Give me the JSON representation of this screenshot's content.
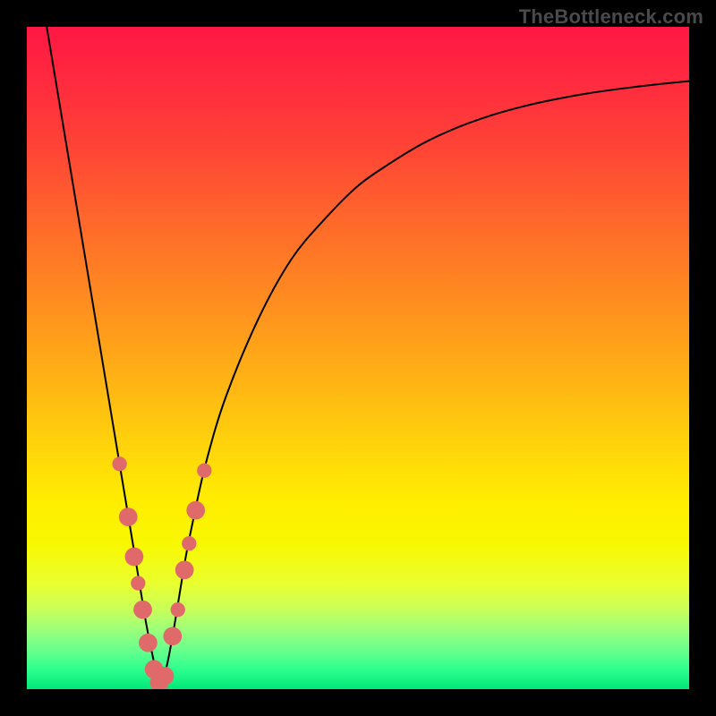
{
  "watermark": "TheBottleneck.com",
  "colors": {
    "frame": "#000000",
    "gradient_top": "#ff1744",
    "gradient_bottom": "#00e879",
    "curve": "#000000",
    "marker": "#e06a6a"
  },
  "chart_data": {
    "type": "line",
    "title": "",
    "xlabel": "",
    "ylabel": "",
    "xlim": [
      0,
      100
    ],
    "ylim": [
      0,
      100
    ],
    "series": [
      {
        "name": "bottleneck-curve",
        "x": [
          3,
          5,
          7,
          9,
          11,
          13,
          14,
          15,
          16,
          17,
          18,
          19,
          20,
          21,
          22,
          23,
          24,
          25,
          27,
          30,
          35,
          40,
          45,
          50,
          55,
          60,
          65,
          70,
          75,
          80,
          85,
          90,
          95,
          100
        ],
        "y": [
          100,
          88,
          76,
          64,
          52,
          40,
          34,
          28,
          22,
          16,
          10,
          5,
          1,
          3,
          8,
          14,
          20,
          25,
          34,
          44,
          56,
          65,
          71,
          76,
          79.5,
          82.5,
          84.8,
          86.6,
          88,
          89.1,
          90,
          90.7,
          91.3,
          91.8
        ]
      }
    ],
    "markers": [
      {
        "x": 14.0,
        "y": 34,
        "r": 1.1
      },
      {
        "x": 15.3,
        "y": 26,
        "r": 1.4
      },
      {
        "x": 16.2,
        "y": 20,
        "r": 1.4
      },
      {
        "x": 16.8,
        "y": 16,
        "r": 1.1
      },
      {
        "x": 17.5,
        "y": 12,
        "r": 1.4
      },
      {
        "x": 18.3,
        "y": 7,
        "r": 1.4
      },
      {
        "x": 19.2,
        "y": 3,
        "r": 1.4
      },
      {
        "x": 20.0,
        "y": 1,
        "r": 1.4
      },
      {
        "x": 20.8,
        "y": 2,
        "r": 1.4
      },
      {
        "x": 22.0,
        "y": 8,
        "r": 1.4
      },
      {
        "x": 22.8,
        "y": 12,
        "r": 1.1
      },
      {
        "x": 23.8,
        "y": 18,
        "r": 1.4
      },
      {
        "x": 24.5,
        "y": 22,
        "r": 1.1
      },
      {
        "x": 25.5,
        "y": 27,
        "r": 1.4
      },
      {
        "x": 26.8,
        "y": 33,
        "r": 1.1
      }
    ],
    "annotations": []
  }
}
